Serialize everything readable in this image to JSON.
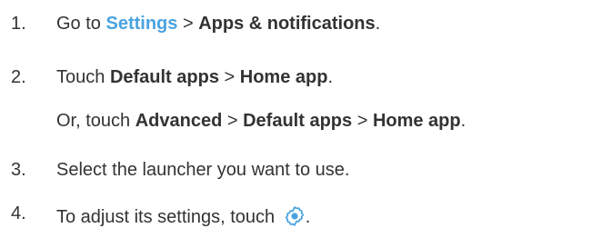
{
  "steps": [
    {
      "number": "1.",
      "prefix": "Go to ",
      "settings_link": "Settings",
      "sep": " > ",
      "target": "Apps & notifications",
      "end": "."
    },
    {
      "number": "2.",
      "prefix": "Touch ",
      "item1": "Default apps",
      "sep": " > ",
      "item2": "Home app",
      "end": "."
    },
    {
      "alt_prefix": "Or, touch ",
      "item1": "Advanced",
      "sep1": " > ",
      "item2": "Default apps",
      "sep2": " > ",
      "item3": "Home app",
      "end": "."
    },
    {
      "number": "3.",
      "text": "Select the launcher you want to use."
    },
    {
      "number": "4.",
      "text": "To adjust its settings, touch ",
      "icon": "settings-gear-icon",
      "end": "."
    }
  ],
  "colors": {
    "text": "#333333",
    "link": "#4aa3df",
    "icon": "#4aa3df"
  }
}
